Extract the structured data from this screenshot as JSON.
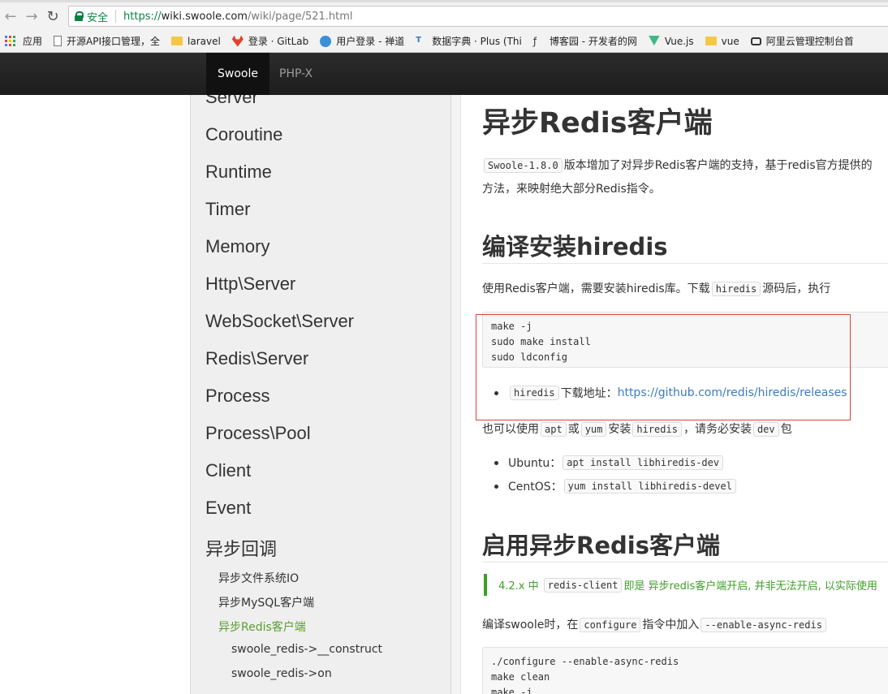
{
  "browser": {
    "secure_label": "安全",
    "url_scheme": "https://",
    "url_host": "wiki.swoole.com",
    "url_path": "/wiki/page/521.html",
    "bookmarks": [
      "应用",
      "开源API接口管理，全",
      "laravel",
      "登录 · GitLab",
      "用户登录 - 禅道",
      "数据字典 · Plus (Thi",
      "博客园 - 开发者的网",
      "Vue.js",
      "vue",
      "阿里云管理控制台首"
    ]
  },
  "site_nav": {
    "tabs": [
      "Swoole",
      "PHP-X"
    ]
  },
  "sidebar": {
    "items": [
      "Server",
      "Coroutine",
      "Runtime",
      "Timer",
      "Memory",
      "Http\\Server",
      "WebSocket\\Server",
      "Redis\\Server",
      "Process",
      "Process\\Pool",
      "Client",
      "Event",
      "异步回调"
    ],
    "sub_items": [
      "异步文件系统IO",
      "异步MySQL客户端",
      "异步Redis客户端"
    ],
    "sub_sub_items": [
      "swoole_redis->__construct",
      "swoole_redis->on"
    ]
  },
  "content": {
    "title": "异步Redis客户端",
    "intro_code": "Swoole-1.8.0",
    "intro_text": "版本增加了对异步Redis客户端的支持，基于redis官方提供的",
    "intro_line2": "方法，来映射绝大部分Redis指令。",
    "h2_compile": "编译安装hiredis",
    "p_need": "使用Redis客户端，需要安装hiredis库。下载",
    "p_need_code": "hiredis",
    "p_need_tail": "源码后，执行",
    "code1": "make -j\nsudo make install\nsudo ldconfig",
    "bullet_dl_code": "hiredis",
    "bullet_dl_text": "下载地址：",
    "bullet_dl_link": "https://github.com/redis/hiredis/releases",
    "p_also_1": "也可以使用",
    "p_also_apt": "apt",
    "p_also_or": "或",
    "p_also_yum": "yum",
    "p_also_install": "安装",
    "p_also_hiredis": "hiredis",
    "p_also_must": "，请务必安装",
    "p_also_dev": "dev",
    "p_also_pkg": "包",
    "ubuntu_label": "Ubuntu：",
    "ubuntu_cmd": "apt install libhiredis-dev",
    "centos_label": "CentOS：",
    "centos_cmd": "yum install libhiredis-devel",
    "h2_enable": "启用异步Redis客户端",
    "tip_prefix": "4.2.x 中",
    "tip_code": "redis-client",
    "tip_text": "即是 异步redis客户端开启, 并非无法开启, 以实际使用",
    "p_compile_1": "编译swoole时，在",
    "p_compile_code": "configure",
    "p_compile_2": "指令中加入",
    "p_compile_flag": "--enable-async-redis",
    "code2": "./configure --enable-async-redis\nmake clean\nmake -j"
  }
}
